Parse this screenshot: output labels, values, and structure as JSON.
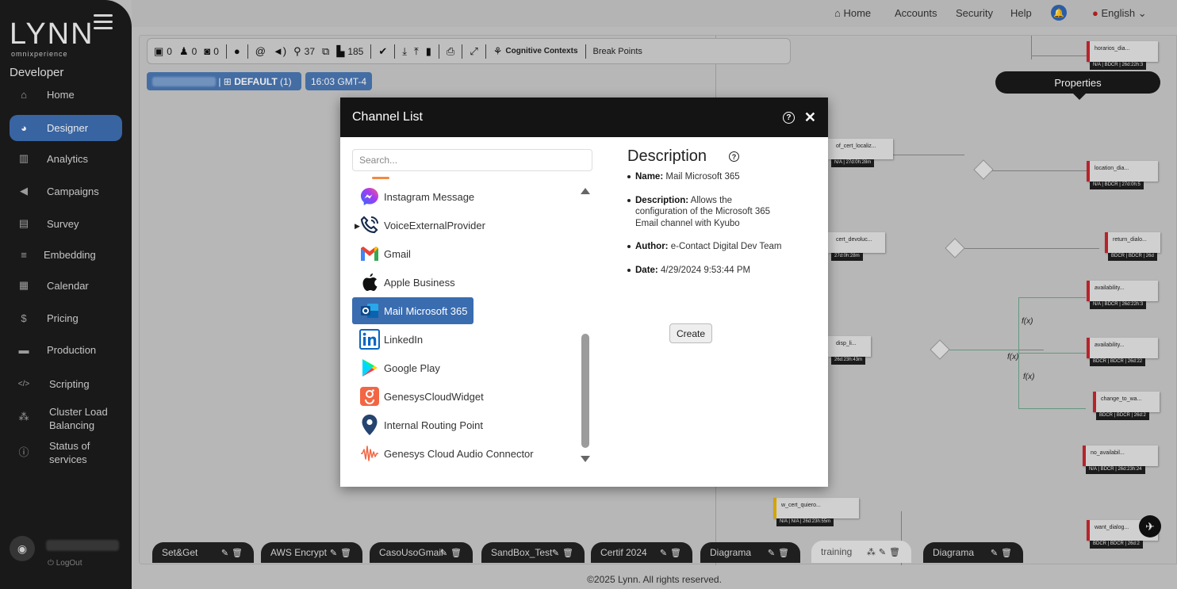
{
  "brand": {
    "logo": "LYNN",
    "tagline": "omnixperience",
    "role": "Developer"
  },
  "sidebar": {
    "items": [
      {
        "label": "Home",
        "icon": "home-icon",
        "glyph": "⌂"
      },
      {
        "label": "Designer",
        "icon": "palette-icon",
        "glyph": "◕"
      },
      {
        "label": "Analytics",
        "icon": "bar-chart-icon",
        "glyph": "▥"
      },
      {
        "label": "Campaigns",
        "icon": "megaphone-icon",
        "glyph": "◀"
      },
      {
        "label": "Survey",
        "icon": "clipboard-icon",
        "glyph": "▤"
      },
      {
        "label": "Embedding",
        "icon": "layers-icon",
        "glyph": "≡"
      },
      {
        "label": "Calendar",
        "icon": "calendar-icon",
        "glyph": "▦"
      },
      {
        "label": "Pricing",
        "icon": "dollar-icon",
        "glyph": "$"
      },
      {
        "label": "Production",
        "icon": "briefcase-icon",
        "glyph": "▬"
      },
      {
        "label": "Scripting",
        "icon": "code-icon",
        "glyph": "</>"
      },
      {
        "label": "Cluster Load Balancing",
        "icon": "network-icon",
        "glyph": "⁂"
      },
      {
        "label": "Status of services",
        "icon": "info-icon",
        "glyph": "ⓘ"
      }
    ],
    "logout": "LogOut"
  },
  "topnav": {
    "home": "Home",
    "accounts": "Accounts",
    "security": "Security",
    "help": "Help",
    "language": "English"
  },
  "toolbar": {
    "count_1": "0",
    "count_2": "0",
    "count_3": "0",
    "count_search": "37",
    "count_files": "185",
    "cognitive": "Cognitive Contexts",
    "breakpoints": "Break Points"
  },
  "chips": {
    "default": "DEFAULT",
    "default_count": "(1)",
    "time": "16:03 GMT-4"
  },
  "properties": "Properties",
  "dialog": {
    "title": "Channel List",
    "search_placeholder": "Search...",
    "channels": [
      {
        "label": "Instagram Message",
        "icon": "messenger-icon"
      },
      {
        "label": "VoiceExternalProvider",
        "icon": "phone-icon"
      },
      {
        "label": "Gmail",
        "icon": "gmail-icon"
      },
      {
        "label": "Apple Business",
        "icon": "apple-icon"
      },
      {
        "label": "Mail Microsoft 365",
        "icon": "outlook-icon"
      },
      {
        "label": "LinkedIn",
        "icon": "linkedin-icon"
      },
      {
        "label": "Google Play",
        "icon": "google-play-icon"
      },
      {
        "label": "GenesysCloudWidget",
        "icon": "genesys-icon"
      },
      {
        "label": "Internal Routing Point",
        "icon": "location-pin-icon"
      },
      {
        "label": "Genesys Cloud Audio Connector",
        "icon": "audio-wave-icon"
      }
    ],
    "selected": "Mail Microsoft 365",
    "description": {
      "heading": "Description",
      "name_label": "Name:",
      "name": "Mail Microsoft 365",
      "desc_label": "Description:",
      "desc": "Allows the configuration of the Microsoft 365 Email channel with Kyubo",
      "author_label": "Author:",
      "author": "e-Contact Digital Dev Team",
      "date_label": "Date:",
      "date": "4/29/2024 9:53:44 PM"
    },
    "create": "Create"
  },
  "nodes": [
    {
      "label": "horarios_dia...",
      "tag": "N/A | BDCR | 26d:22h:3"
    },
    {
      "label": "location_dia...",
      "tag": "N/A | BDCR | 27d:0h:5"
    },
    {
      "label": "return_dialo...",
      "tag": "BDCR | BDCR | 26d"
    },
    {
      "label": "availability...",
      "tag": "N/A | BDCR | 26d:22h:3"
    },
    {
      "label": "availability...",
      "tag": "BDCR | BDCR | 26d:22"
    },
    {
      "label": "change_to_wa...",
      "tag": "BDCR | BDCR | 26d:2"
    },
    {
      "label": "no_availabil...",
      "tag": "N/A | BDCR | 26d:23h:24"
    },
    {
      "label": "want_dialog...",
      "tag": "BDCR | BDCR | 26d:2"
    },
    {
      "label": "of_cert_localiz...",
      "tag": "N/A | 27d:0h:28m"
    },
    {
      "label": "cert_devoluc...",
      "tag": "27d:0h:28m"
    },
    {
      "label": "disp_li...",
      "tag": "26d:23h:43m"
    },
    {
      "label": "w_cert_quiero...",
      "tag": "N/A | N/A | 26d:23h:55m"
    }
  ],
  "tabs": [
    "Set&Get",
    "AWS Encrypt",
    "CasoUsoGmail",
    "SandBox_Test",
    "Certif 2024",
    "Diagrama",
    "training",
    "Diagrama"
  ],
  "active_tab": "training",
  "footer": "©2025 Lynn. All rights reserved."
}
